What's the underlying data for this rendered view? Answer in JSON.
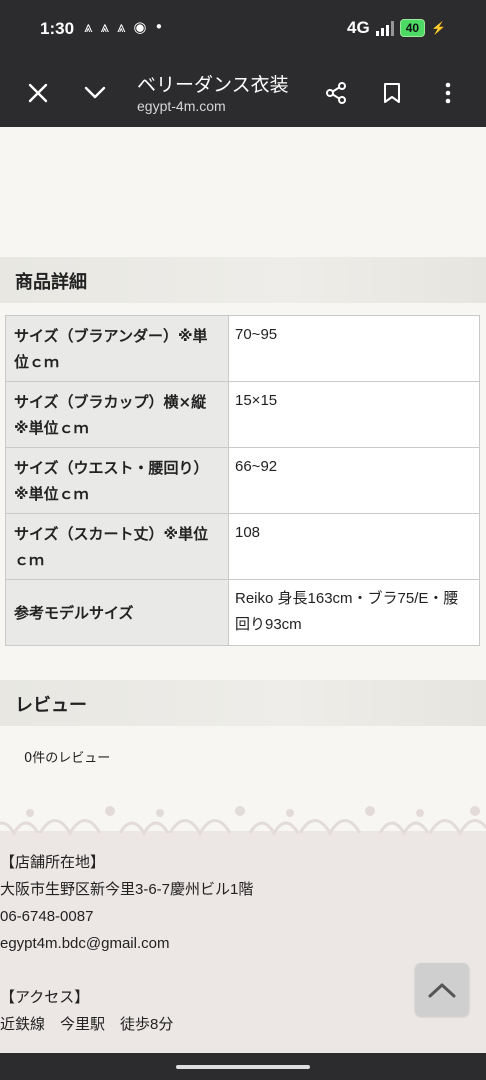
{
  "status_bar": {
    "time": "1:30",
    "network": "4G",
    "battery": "40",
    "notification_icons": [
      "⩓",
      "⩓",
      "⩓",
      "◉",
      "•"
    ]
  },
  "browser": {
    "title": "ベリーダンス衣装",
    "url": "egypt-4m.com"
  },
  "product_details": {
    "heading": "商品詳細",
    "rows": [
      {
        "label": "サイズ（ブラアンダー）※単位ｃｍ",
        "value": "70~95"
      },
      {
        "label": "サイズ（ブラカップ）横×縦※単位ｃｍ",
        "value": "15×15"
      },
      {
        "label": "サイズ（ウエスト・腰回り）※単位ｃｍ",
        "value": "66~92"
      },
      {
        "label": "サイズ（スカート丈）※単位ｃｍ",
        "value": "108"
      },
      {
        "label": "参考モデルサイズ",
        "value": "Reiko 身長163cm・ブラ75/E・腰回り93cm"
      }
    ]
  },
  "reviews": {
    "heading": "レビュー",
    "count_text": "0件のレビュー"
  },
  "footer": {
    "store_heading": "【店舗所在地】",
    "address": "大阪市生野区新今里3-6-7慶州ビル1階",
    "phone": "06-6748-0087",
    "email": "egypt4m.bdc@gmail.com",
    "access_heading": "【アクセス】",
    "access_line": "近鉄線　今里駅　徒歩8分"
  },
  "colors": {
    "chrome": "#2c2c2e",
    "battery": "#4cd964",
    "footer_bg": "#ece6e5",
    "label_bg": "#e9e9e7"
  }
}
